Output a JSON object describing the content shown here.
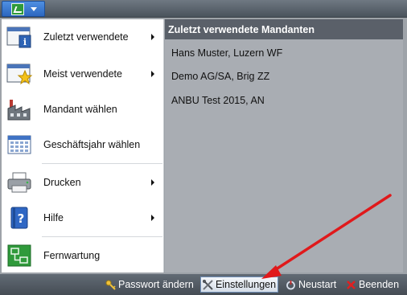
{
  "menu": {
    "items": [
      {
        "label": "Zuletzt verwendete",
        "icon": "recent-window-info-icon",
        "submenu": true
      },
      {
        "label": "Meist verwendete",
        "icon": "star-window-icon",
        "submenu": true
      },
      {
        "label": "Mandant wählen",
        "icon": "factory-icon",
        "submenu": false
      },
      {
        "label": "Geschäftsjahr wählen",
        "icon": "calendar-icon",
        "submenu": false
      },
      {
        "label": "Drucken",
        "icon": "printer-icon",
        "submenu": true
      },
      {
        "label": "Hilfe",
        "icon": "help-book-icon",
        "submenu": true
      },
      {
        "label": "Fernwartung",
        "icon": "remote-network-icon",
        "submenu": false
      }
    ]
  },
  "panel": {
    "title": "Zuletzt verwendete Mandanten",
    "entries": [
      "Hans Muster, Luzern WF",
      "Demo AG/SA, Brig ZZ",
      "ANBU Test 2015,  AN"
    ]
  },
  "bottombar": {
    "password": "Passwort ändern",
    "settings": "Einstellungen",
    "restart": "Neustart",
    "quit": "Beenden"
  },
  "colors": {
    "arrow": "#e0191b",
    "panel_header": "#5a6069",
    "app_button": "#2c67c0"
  }
}
